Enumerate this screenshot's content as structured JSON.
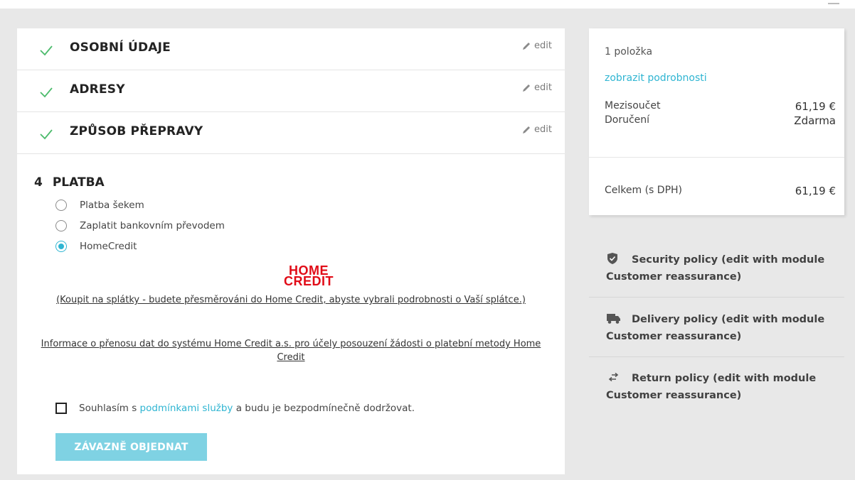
{
  "steps": [
    {
      "title": "OSOBNÍ ÚDAJE",
      "edit": "edit"
    },
    {
      "title": "ADRESY",
      "edit": "edit"
    },
    {
      "title": "ZPŮSOB PŘEPRAVY",
      "edit": "edit"
    }
  ],
  "payment": {
    "number": "4",
    "title": "PLATBA",
    "options": [
      {
        "label": "Platba šekem",
        "selected": false
      },
      {
        "label": "Zaplatit bankovním převodem",
        "selected": false
      },
      {
        "label": "HomeCredit",
        "selected": true
      }
    ],
    "logo_line1": "HOME",
    "logo_line2": "CREDIT",
    "info_link": "(Koupit na splátky - budete přesměrováni do Home Credit, abyste vybrali podrobnosti o Vaší splátce.)",
    "data_link": "Informace o přenosu dat do systému Home Credit a.s. pro účely posouzení žádosti o platební metody Home Credit",
    "agree_prefix": "Souhlasím s",
    "agree_link": "podmínkami služby",
    "agree_suffix": "a budu je bezpodmínečně dodržovat.",
    "order_button": "ZÁVAZNĚ OBJEDNAT"
  },
  "summary": {
    "items_count": "1 položka",
    "show_details": "zobrazit podrobnosti",
    "subtotal_label": "Mezisoučet",
    "subtotal_value": "61,19 €",
    "shipping_label": "Doručení",
    "shipping_value": "Zdarma",
    "total_label": "Celkem (s DPH)",
    "total_value": "61,19 €"
  },
  "reassurance": [
    {
      "icon": "shield-icon",
      "text": "Security policy (edit with module Customer reassurance)"
    },
    {
      "icon": "truck-icon",
      "text": "Delivery policy (edit with module Customer reassurance)"
    },
    {
      "icon": "exchange-arrows-icon",
      "text": "Return policy (edit with module Customer reassurance)"
    }
  ],
  "colors": {
    "accent": "#2fb5d2",
    "check": "#4cbb6c",
    "homecredit_red": "#e10b17",
    "button": "#7fd2e3"
  }
}
